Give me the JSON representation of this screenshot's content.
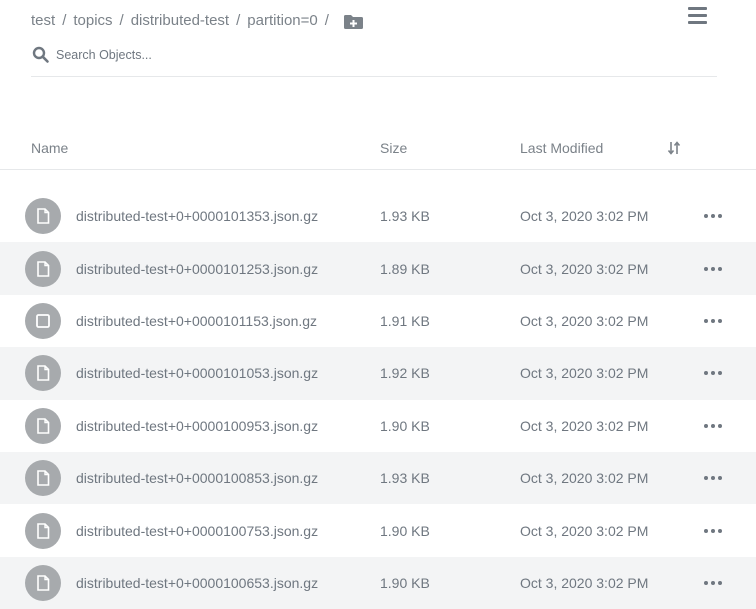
{
  "breadcrumb": {
    "items": [
      "test",
      "topics",
      "distributed-test",
      "partition=0"
    ],
    "separator": "/"
  },
  "search": {
    "placeholder": "Search Objects..."
  },
  "table": {
    "columns": {
      "name": "Name",
      "size": "Size",
      "last_modified": "Last Modified"
    },
    "rows": [
      {
        "icon": "file-icon",
        "name": "distributed-test+0+0000101353.json.gz",
        "size": "1.93 KB",
        "modified": "Oct 3, 2020 3:02 PM"
      },
      {
        "icon": "file-icon",
        "name": "distributed-test+0+0000101253.json.gz",
        "size": "1.89 KB",
        "modified": "Oct 3, 2020 3:02 PM"
      },
      {
        "icon": "checkbox-icon",
        "name": "distributed-test+0+0000101153.json.gz",
        "size": "1.91 KB",
        "modified": "Oct 3, 2020 3:02 PM"
      },
      {
        "icon": "file-icon",
        "name": "distributed-test+0+0000101053.json.gz",
        "size": "1.92 KB",
        "modified": "Oct 3, 2020 3:02 PM"
      },
      {
        "icon": "file-icon",
        "name": "distributed-test+0+0000100953.json.gz",
        "size": "1.90 KB",
        "modified": "Oct 3, 2020 3:02 PM"
      },
      {
        "icon": "file-icon",
        "name": "distributed-test+0+0000100853.json.gz",
        "size": "1.93 KB",
        "modified": "Oct 3, 2020 3:02 PM"
      },
      {
        "icon": "file-icon",
        "name": "distributed-test+0+0000100753.json.gz",
        "size": "1.90 KB",
        "modified": "Oct 3, 2020 3:02 PM"
      },
      {
        "icon": "file-icon",
        "name": "distributed-test+0+0000100653.json.gz",
        "size": "1.90 KB",
        "modified": "Oct 3, 2020 3:02 PM"
      }
    ]
  },
  "icons": {
    "menu": "hamburger-menu-icon",
    "search": "search-icon",
    "add_folder": "folder-plus-icon",
    "sort": "sort-icon",
    "row_actions": "more-horizontal-icon"
  },
  "colors": {
    "text": "#6f7780",
    "icon_circle": "#a7aaad",
    "row_alt": "#f3f4f5",
    "divider": "#e6e8ea"
  }
}
